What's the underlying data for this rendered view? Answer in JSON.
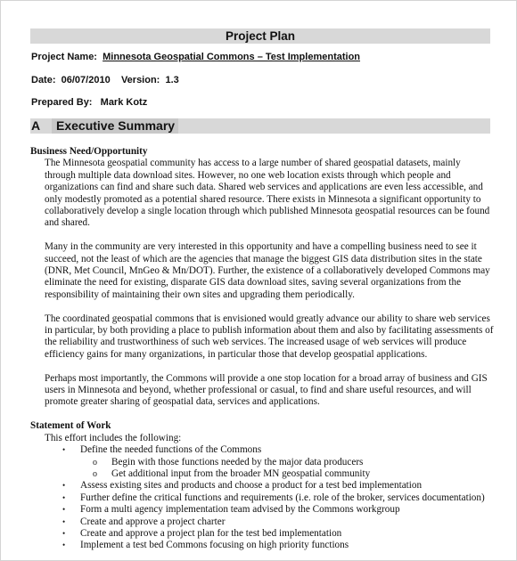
{
  "document": {
    "title": "Project Plan",
    "meta": {
      "project_name_label": "Project Name:",
      "project_name_value": "Minnesota Geospatial Commons – Test Implementation",
      "date_label": "Date:",
      "date_value": "06/07/2010",
      "version_label": "Version:",
      "version_value": "1.3",
      "prepared_by_label": "Prepared By:",
      "prepared_by_value": "Mark Kotz"
    },
    "section": {
      "letter": "A",
      "heading": "Executive Summary"
    },
    "business_need": {
      "heading": "Business Need/Opportunity",
      "paragraphs": [
        "The Minnesota geospatial community has access to a large number of shared geospatial datasets, mainly through multiple data download sites.  However, no one web location exists through which people and organizations can find and share such data.  Shared web services and applications are even less accessible, and only modestly promoted as a potential shared resource.  There exists in Minnesota a significant opportunity to collaboratively develop a single location through which published Minnesota geospatial resources can be found and shared.",
        "Many in the community are very interested in this opportunity and have a compelling business need to see it succeed, not the least of which are the agencies that manage the biggest GIS data distribution sites in the state (DNR, Met Council, MnGeo & Mn/DOT).  Further, the existence of a collaboratively developed Commons may eliminate the need for existing, disparate GIS data download sites, saving several organizations from the responsibility of maintaining their own sites and upgrading them periodically.",
        "The coordinated geospatial commons that is envisioned would greatly advance our ability to share web services in particular, by both providing a place to publish information about them and also by facilitating assessments of the reliability and trustworthiness of such web services.  The increased usage of web services will produce efficiency gains for many organizations, in particular those that develop geospatial applications.",
        "Perhaps most importantly, the Commons will provide a one stop location for a broad array of business and GIS users in Minnesota and beyond, whether professional or casual, to find and share useful resources, and will promote greater sharing of geospatial data, services and applications."
      ]
    },
    "statement_of_work": {
      "heading": "Statement of Work",
      "intro": "This effort includes the following:",
      "bullet_glyph": "•",
      "sub_bullet_glyph": "o",
      "items": [
        {
          "level": 1,
          "text": "Define the needed functions of the Commons"
        },
        {
          "level": 2,
          "text": "Begin with those functions needed by the major data producers"
        },
        {
          "level": 2,
          "text": "Get additional input from the broader MN geospatial community"
        },
        {
          "level": 1,
          "text": "Assess existing sites and products and choose a product for a test bed implementation"
        },
        {
          "level": 1,
          "text": "Further define the critical functions and requirements (i.e. role of the broker, services documentation)"
        },
        {
          "level": 1,
          "text": "Form a multi agency implementation team advised by the Commons workgroup"
        },
        {
          "level": 1,
          "text": "Create and approve a project charter"
        },
        {
          "level": 1,
          "text": "Create and approve a project plan for the test bed implementation"
        },
        {
          "level": 1,
          "text": "Implement a test bed Commons focusing on high priority functions"
        }
      ]
    }
  }
}
